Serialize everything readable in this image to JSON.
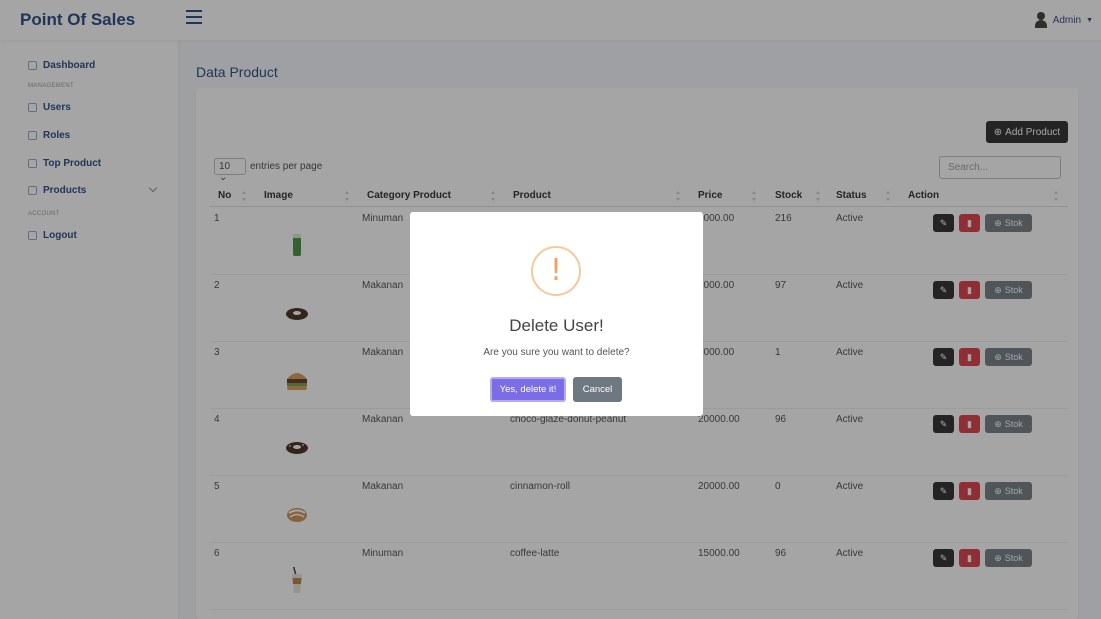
{
  "app": {
    "brand": "Point Of Sales",
    "admin_label": "Admin"
  },
  "sidebar": {
    "items": [
      {
        "label": "Dashboard",
        "icon": "grid-icon"
      },
      {
        "section": "MANAGEMENT"
      },
      {
        "label": "Users",
        "icon": "users-icon"
      },
      {
        "label": "Roles",
        "icon": "roles-icon"
      },
      {
        "label": "Top Product",
        "icon": "chart-icon"
      },
      {
        "label": "Products",
        "icon": "box-icon"
      },
      {
        "section": "ACCOUNT"
      },
      {
        "label": "Logout",
        "icon": "logout-icon"
      }
    ]
  },
  "main": {
    "title": "Data Product",
    "add_button": "Add Product",
    "entries_value": "10",
    "entries_label": "entries per page",
    "search_placeholder": "Search...",
    "columns": [
      "No",
      "Image",
      "Category Product",
      "Product",
      "Price",
      "Stock",
      "Status",
      "Action"
    ],
    "rows": [
      {
        "no": "1",
        "category": "Minuman",
        "product": "",
        "price": "0000.00",
        "stock": "216",
        "status": "Active",
        "image": "green-drink"
      },
      {
        "no": "2",
        "category": "Makanan",
        "product": "",
        "price": "2000.00",
        "stock": "97",
        "status": "Active",
        "image": "donut"
      },
      {
        "no": "3",
        "category": "Makanan",
        "product": "",
        "price": "5000.00",
        "stock": "1",
        "status": "Active",
        "image": "burger"
      },
      {
        "no": "4",
        "category": "Makanan",
        "product": "choco-glaze-donut-peanut",
        "price": "20000.00",
        "stock": "96",
        "status": "Active",
        "image": "donut"
      },
      {
        "no": "5",
        "category": "Makanan",
        "product": "cinnamon-roll",
        "price": "20000.00",
        "stock": "0",
        "status": "Active",
        "image": "roll"
      },
      {
        "no": "6",
        "category": "Minuman",
        "product": "coffee-latte",
        "price": "15000.00",
        "stock": "96",
        "status": "Active",
        "image": "latte"
      }
    ],
    "stok_label": "Stok"
  },
  "modal": {
    "icon": "exclamation-icon",
    "title": "Delete User!",
    "text": "Are you sure you want to delete?",
    "confirm": "Yes, delete it!",
    "cancel": "Cancel"
  },
  "colors": {
    "brand": "#1a3e7a",
    "confirm": "#7b6de6",
    "cancel": "#6e7881",
    "warning": "#f2a15f",
    "delete": "#d9323f"
  }
}
